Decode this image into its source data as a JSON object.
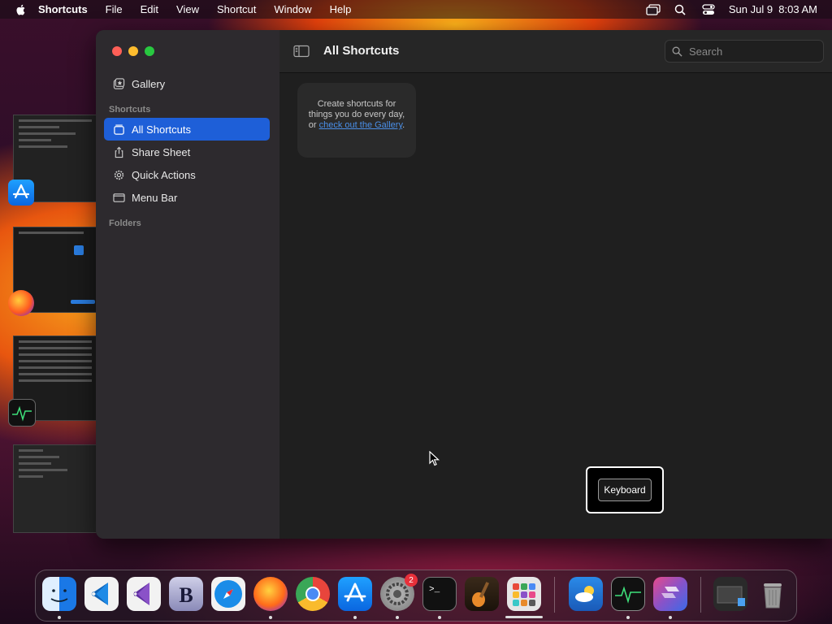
{
  "menubar": {
    "app_name": "Shortcuts",
    "items": [
      "File",
      "Edit",
      "View",
      "Shortcut",
      "Window",
      "Help"
    ],
    "datetime": "Sun Jul 9  8:03 AM"
  },
  "sidebar": {
    "gallery_label": "Gallery",
    "shortcuts_header": "Shortcuts",
    "items": [
      {
        "label": "All Shortcuts",
        "icon": "stack-icon",
        "active": true
      },
      {
        "label": "Share Sheet",
        "icon": "share-icon",
        "active": false
      },
      {
        "label": "Quick Actions",
        "icon": "gear-icon",
        "active": false
      },
      {
        "label": "Menu Bar",
        "icon": "menubar-icon",
        "active": false
      }
    ],
    "folders_header": "Folders"
  },
  "toolbar": {
    "title": "All Shortcuts",
    "search_placeholder": "Search"
  },
  "content": {
    "empty_text": "Create shortcuts for things you do every day, or",
    "link_text": "check out the Gallery",
    "after_link": "."
  },
  "keyboard_overlay": {
    "label": "Keyboard"
  },
  "dock": {
    "apps": [
      "Finder",
      "Visual Studio Code",
      "Visual Studio",
      "BBEdit",
      "Safari",
      "Firefox",
      "Google Chrome",
      "App Store",
      "System Settings",
      "Terminal",
      "GarageBand",
      "Launchpad",
      "Weather",
      "Activity Monitor",
      "Shortcuts",
      "Downloads",
      "Trash"
    ],
    "settings_badge": "2"
  },
  "colors": {
    "accent": "#1e5fd8",
    "link": "#4a8fe8"
  }
}
